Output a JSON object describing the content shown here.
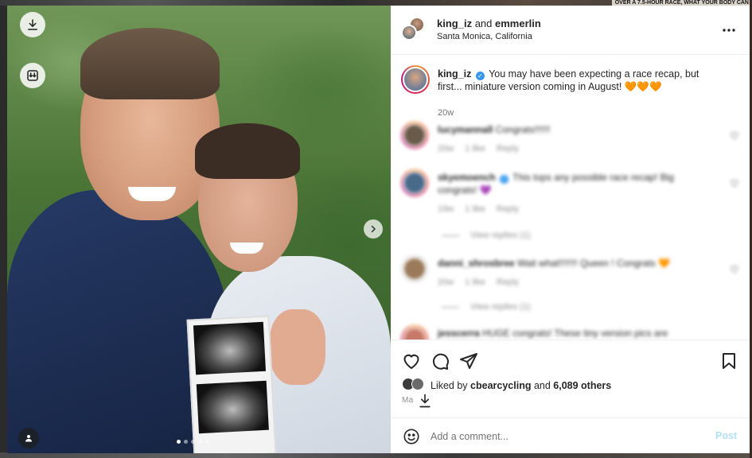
{
  "background": {
    "banner_text": "OVER A 7.5-HOUR RACE, WHAT YOUR BODY CAN"
  },
  "media": {
    "download_icon": "download-icon",
    "save_all_icon": "download-all-icon",
    "next_icon": "chevron-right-icon",
    "tag_icon": "user-tag-icon",
    "carousel_count": 5,
    "carousel_active_index": 0
  },
  "header": {
    "user1": "king_iz",
    "and": " and ",
    "user2": "emmerlin",
    "location": "Santa Monica, California",
    "more_icon": "more-horizontal-icon"
  },
  "caption": {
    "username": "king_iz",
    "text": "You may have been expecting a race recap, but first... miniature version coming in August! 🧡🧡🧡",
    "time": "20w"
  },
  "comments": [
    {
      "username": "lucymannall",
      "text": "Congrats!!!!!!",
      "time": "20w",
      "likes": "1 like",
      "reply": "Reply",
      "view_replies": ""
    },
    {
      "username": "skyemoench",
      "text": "This tops any possible race recap! Big congrats! 💜",
      "time": "19w",
      "likes": "1 like",
      "reply": "Reply",
      "view_replies": "View replies (1)"
    },
    {
      "username": "danni_shrosbree",
      "text": "Wait what!!!!!!! Queen ! Congrats 🧡",
      "time": "20w",
      "likes": "1 like",
      "reply": "Reply",
      "view_replies": "View replies (1)"
    },
    {
      "username": "jesscerra",
      "text": "HUGE congrats! These tiny version pics are",
      "time": "",
      "likes": "",
      "reply": "",
      "view_replies": ""
    }
  ],
  "actions": {
    "liked_prefix": "Liked by ",
    "liked_user": "cbearcycling",
    "liked_and": " and ",
    "liked_others": "6,089 others",
    "date": "Ma"
  },
  "add_comment": {
    "placeholder": "Add a comment...",
    "post_label": "Post"
  },
  "colors": {
    "verified": "#3897f0",
    "post_disabled": "#b2dffc",
    "text": "#262626",
    "muted": "#8e8e8e"
  }
}
